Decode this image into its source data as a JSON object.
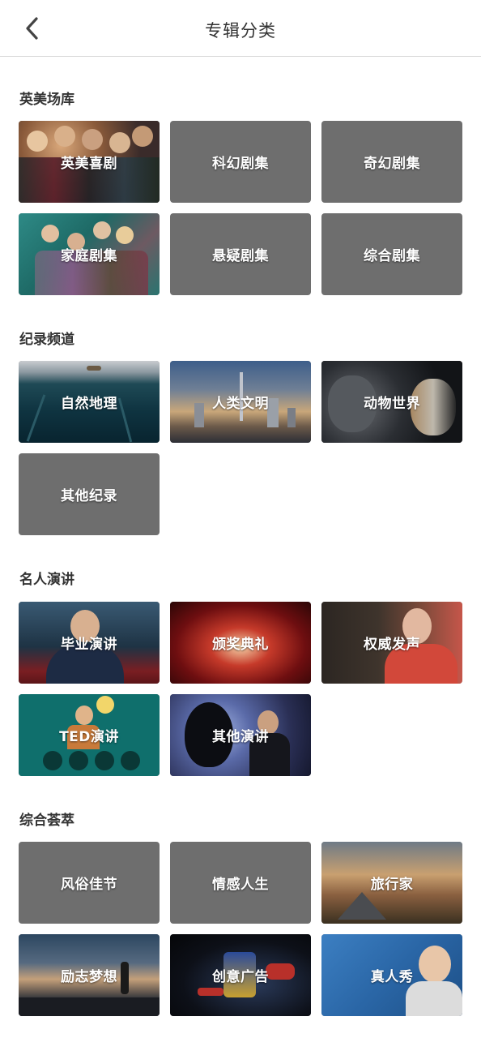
{
  "header": {
    "title": "专辑分类"
  },
  "sections": [
    {
      "title": "英美场库",
      "items": [
        {
          "label": "英美喜剧"
        },
        {
          "label": "科幻剧集"
        },
        {
          "label": "奇幻剧集"
        },
        {
          "label": "家庭剧集"
        },
        {
          "label": "悬疑剧集"
        },
        {
          "label": "综合剧集"
        }
      ]
    },
    {
      "title": "纪录频道",
      "items": [
        {
          "label": "自然地理"
        },
        {
          "label": "人类文明"
        },
        {
          "label": "动物世界"
        },
        {
          "label": "其他纪录"
        }
      ]
    },
    {
      "title": "名人演讲",
      "items": [
        {
          "label": "毕业演讲"
        },
        {
          "label": "颁奖典礼"
        },
        {
          "label": "权威发声"
        },
        {
          "label": "TED演讲"
        },
        {
          "label": "其他演讲"
        }
      ]
    },
    {
      "title": "综合荟萃",
      "items": [
        {
          "label": "风俗佳节"
        },
        {
          "label": "情感人生"
        },
        {
          "label": "旅行家"
        },
        {
          "label": "励志梦想"
        },
        {
          "label": "创意广告"
        },
        {
          "label": "真人秀"
        }
      ]
    }
  ],
  "colors": {
    "placeholder_tile": "#6e6e6e",
    "divider": "#d8d8d8",
    "text": "#333333"
  }
}
